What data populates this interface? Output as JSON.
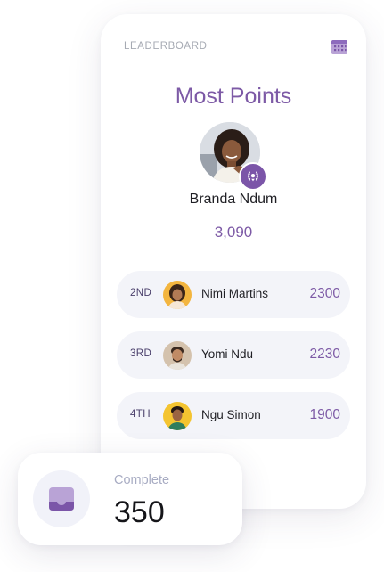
{
  "leaderboard": {
    "label": "LEADERBOARD",
    "title": "Most Points",
    "accent_color": "#7d5aa6",
    "calendar_icon": "calendar-icon",
    "winner": {
      "name": "Branda Ndum",
      "points": "3,090",
      "badge_icon": "laurel-wreath-icon"
    },
    "ranks": [
      {
        "position": "2ND",
        "name": "Nimi Martins",
        "score": "2300",
        "avatar_bg": "#f3b53f"
      },
      {
        "position": "3RD",
        "name": "Yomi Ndu",
        "score": "2230",
        "avatar_bg": "#d4c2ad"
      },
      {
        "position": "4TH",
        "name": "Ngu Simon",
        "score": "1900",
        "avatar_bg": "#f4c430"
      }
    ]
  },
  "complete": {
    "label": "Complete",
    "value": "350",
    "icon": "inbox-tray-icon"
  }
}
